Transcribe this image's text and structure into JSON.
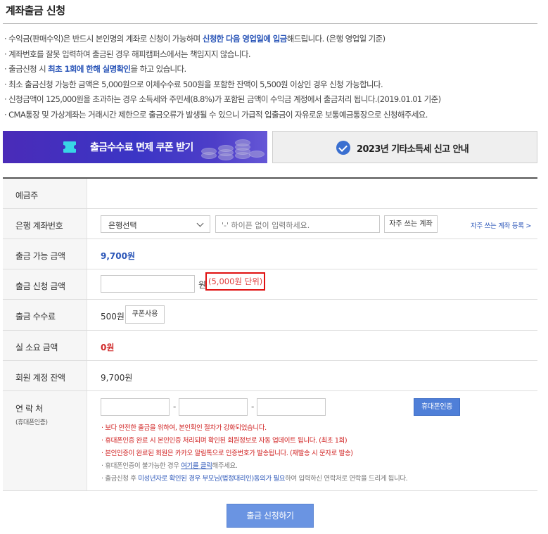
{
  "page": {
    "title": "계좌출금 신청"
  },
  "notices": [
    {
      "segments": [
        {
          "t": "· 수익금(판매수익)은 반드시 본인명의 계좌로 신청이 가능하며 ",
          "h": false
        },
        {
          "t": "신청한 다음 영업일에 입금",
          "h": true
        },
        {
          "t": "해드립니다. (은행 영업일 기준)",
          "h": false
        }
      ]
    },
    {
      "segments": [
        {
          "t": "· 계좌번호를 잘못 입력하여 출금된 경우 해피캠퍼스에서는 책임지지 않습니다.",
          "h": false
        }
      ]
    },
    {
      "segments": [
        {
          "t": "· 출금신청 시 ",
          "h": false
        },
        {
          "t": "최초 1회에 한해 실명확인",
          "h": true
        },
        {
          "t": "을 하고 있습니다.",
          "h": false
        }
      ]
    },
    {
      "segments": [
        {
          "t": "· 최소 출금신청 가능한 금액은 5,000원으로 이체수수료 500원을 포함한 잔액이 5,500원 이상인 경우 신청 가능합니다.",
          "h": false
        }
      ]
    },
    {
      "segments": [
        {
          "t": "· 신청금액이 125,000원을 초과하는 경우 소득세와 주민세(8.8%)가 포함된 금액이 수익금 계정에서 출금처리 됩니다.(2019.01.01 기준)",
          "h": false
        }
      ]
    },
    {
      "segments": [
        {
          "t": "· CMA통장 및 가상계좌는 거래시간 제한으로 출금오류가 발생될 수 있으니 가급적 입출금이 자유로운 보통예금통장으로 신청해주세요.",
          "h": false
        }
      ]
    }
  ],
  "banners": {
    "coupon": {
      "label": "출금수수료 면제 쿠폰 받기",
      "ticket_color": "#38d6e6",
      "bg_color": "#3b35c5"
    },
    "tax": {
      "label": "2023년 기타소득세 신고 안내",
      "check_color": "#3a6fd0"
    }
  },
  "form": {
    "depositor": {
      "label": "예금주",
      "value": ""
    },
    "bank": {
      "label": "은행 계좌번호",
      "select_value": "은행선택",
      "account_placeholder": "'-' 하이픈 없이 입력하세요.",
      "favorite_button": "자주 쓰는 계좌",
      "register_link": "자주 쓰는 계좌 등록 >"
    },
    "available": {
      "label": "출금 가능 금액",
      "value": "9,700원"
    },
    "request": {
      "label": "출금 신청 금액",
      "unit": "원",
      "unit_note": "(5,000원 단위)",
      "value": ""
    },
    "fee": {
      "label": "출금 수수료",
      "value": "500원",
      "coupon_button": "쿠폰사용"
    },
    "actual": {
      "label": "실 소요 금액",
      "value": "0원"
    },
    "balance": {
      "label": "회원 계정 잔액",
      "value": "9,700원"
    },
    "contact": {
      "label": "연 락 처",
      "sublabel": "(휴대폰인증)",
      "separator": "-",
      "auth_button": "휴대폰인증",
      "notes": [
        {
          "style": "red",
          "text": "· 보다 안전한 출금을 위하여, 본인확인 절차가 강화되었습니다."
        },
        {
          "style": "red",
          "text": "· 휴대폰인증 완료 시 본인인증 처리되며 확인된 회원정보로 자동 업데이트 됩니다. (최초 1회)"
        },
        {
          "style": "red",
          "text": "· 본인인증이 완료된 회원은 카카오 알림톡으로 인증번호가 발송됩니다. (재발송 시 문자로 발송)"
        },
        {
          "style": "gray",
          "pre": "· 휴대폰인증이 불가능한 경우 ",
          "link": "여기를 클릭",
          "post": "해주세요."
        },
        {
          "style": "gray",
          "pre": "· 출금신청 후 ",
          "link": "미성년자로 확인된 경우 부모님(법정대리인)동의가 필요",
          "post": "하여 입력하신 연락처로 연락을 드리게 됩니다."
        }
      ]
    }
  },
  "submit_label": "출금 신청하기",
  "colors": {
    "accent": "#2b56b8",
    "alert": "#d02828",
    "submit": "#6a94e2"
  }
}
